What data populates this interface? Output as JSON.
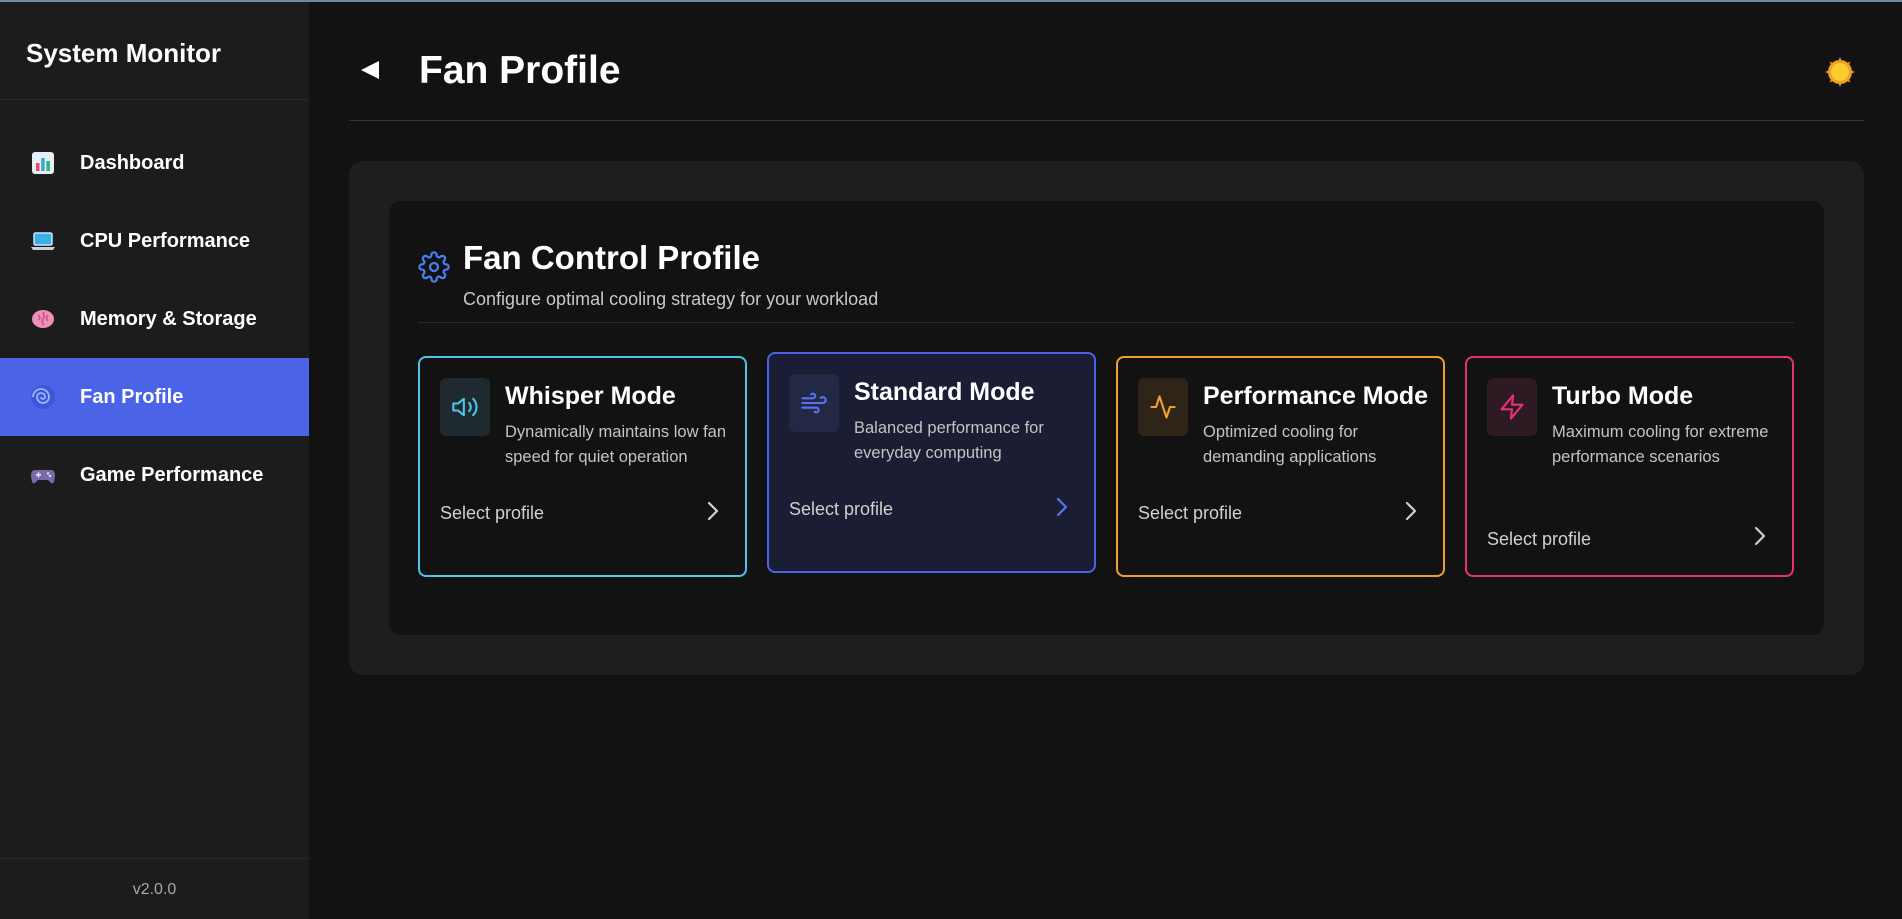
{
  "app": {
    "title": "System Monitor",
    "version": "v2.0.0"
  },
  "sidebar": {
    "items": [
      {
        "label": "Dashboard",
        "icon": "bar-chart-icon"
      },
      {
        "label": "CPU Performance",
        "icon": "laptop-icon"
      },
      {
        "label": "Memory & Storage",
        "icon": "brain-icon"
      },
      {
        "label": "Fan Profile",
        "icon": "cyclone-icon",
        "active": true
      },
      {
        "label": "Game Performance",
        "icon": "gamepad-icon"
      }
    ]
  },
  "header": {
    "title": "Fan Profile",
    "back_icon": "back-triangle-icon",
    "theme_icon": "sun-icon"
  },
  "fan_control": {
    "title": "Fan Control Profile",
    "subtitle": "Configure optimal cooling strategy for your workload",
    "icon": "gear-icon",
    "profiles": [
      {
        "title": "Whisper Mode",
        "description": "Dynamically maintains low fan speed for quiet operation",
        "action": "Select profile",
        "icon": "speaker-icon",
        "color": "#4fc3e8",
        "selected": false
      },
      {
        "title": "Standard Mode",
        "description": "Balanced performance for everyday computing",
        "action": "Select profile",
        "icon": "wind-icon",
        "color": "#4a63e7",
        "selected": true
      },
      {
        "title": "Performance Mode",
        "description": "Optimized cooling for demanding applications",
        "action": "Select profile",
        "icon": "activity-icon",
        "color": "#f0a030",
        "selected": false
      },
      {
        "title": "Turbo Mode",
        "description": "Maximum cooling for extreme performance scenarios",
        "action": "Select profile",
        "icon": "lightning-icon",
        "color": "#e8307a",
        "selected": false
      }
    ]
  },
  "colors": {
    "accent": "#4a63e7",
    "background": "#121212",
    "sidebar": "#1c1c1c"
  }
}
